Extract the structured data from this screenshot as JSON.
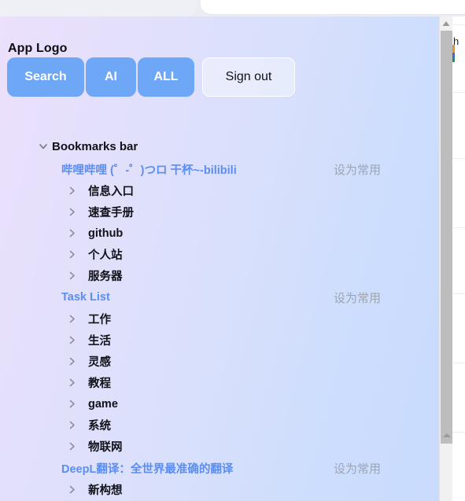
{
  "browser_chrome": {
    "icons": [
      "colorbar-icon",
      "back-arrow-icon",
      "bookmark-star-icon",
      "extension-red-icon",
      "extension-pink-icon",
      "extension-star-icon",
      "extension-panda-icon",
      "extension-fox-icon",
      "profile-avatar-icon"
    ]
  },
  "popup": {
    "app_logo": "App Logo",
    "buttons": {
      "search": "Search",
      "ai": "AI",
      "all": "ALL",
      "sign_out": "Sign out"
    },
    "favorite_badge_label": "设为常用",
    "tree": [
      {
        "type": "root",
        "label": "Bookmarks bar",
        "expanded": true,
        "children": [
          {
            "type": "link",
            "label": "哔哩哔哩 (゜-゜)つロ 干杯~-bilibili",
            "badge": "设为常用"
          },
          {
            "type": "folder",
            "label": "信息入口"
          },
          {
            "type": "folder",
            "label": "速查手册"
          },
          {
            "type": "folder",
            "label": "github"
          },
          {
            "type": "folder",
            "label": "个人站"
          },
          {
            "type": "folder",
            "label": "服务器"
          },
          {
            "type": "link",
            "label": "Task List",
            "badge": "设为常用"
          },
          {
            "type": "folder",
            "label": "工作"
          },
          {
            "type": "folder",
            "label": "生活"
          },
          {
            "type": "folder",
            "label": "灵感"
          },
          {
            "type": "folder",
            "label": "教程"
          },
          {
            "type": "folder",
            "label": "game"
          },
          {
            "type": "folder",
            "label": "系统"
          },
          {
            "type": "folder",
            "label": "物联网"
          },
          {
            "type": "link",
            "label": "DeepL翻译：全世界最准确的翻译",
            "badge": "设为常用"
          },
          {
            "type": "folder",
            "label": "新构想"
          }
        ]
      }
    ]
  },
  "colors": {
    "pill_blue": "#6ea7f5",
    "link_blue": "#5b8ef0",
    "badge_gray": "#9fa5b0",
    "bg_left": "#ece0fc",
    "bg_right": "#c9dbfd",
    "scrollbar_thumb": "#bdbdbd"
  },
  "page_behind": {
    "text_fragment": "h"
  }
}
